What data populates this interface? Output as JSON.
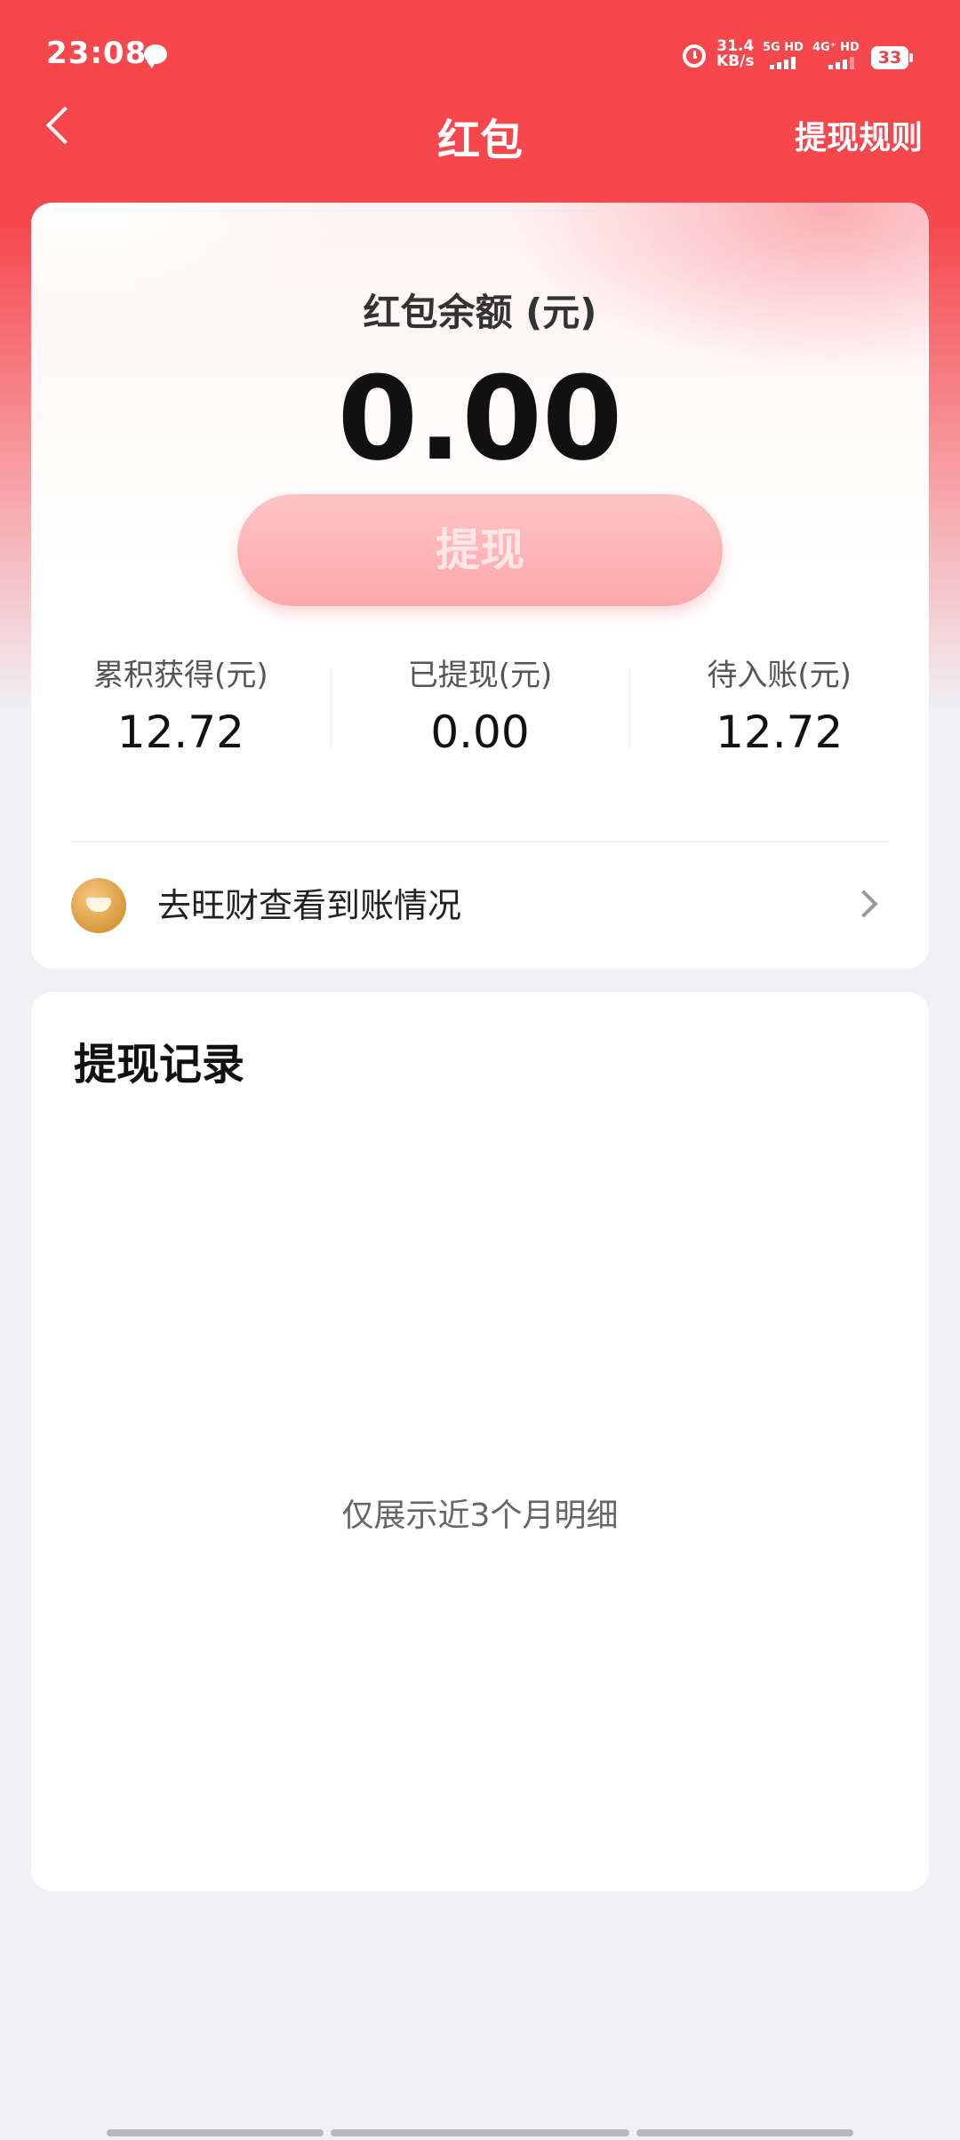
{
  "status_bar": {
    "time": "23:08",
    "net_speed_value": "31.4",
    "net_speed_unit": "KB/s",
    "sim1_label": "5G HD",
    "sim2_label": "4G⁺ HD",
    "battery": "33"
  },
  "nav": {
    "title": "红包",
    "rules_label": "提现规则"
  },
  "balance": {
    "label": "红包余额 (元)",
    "value": "0.00",
    "withdraw_label": "提现"
  },
  "stats": [
    {
      "label": "累积获得(元)",
      "value": "12.72"
    },
    {
      "label": "已提现(元)",
      "value": "0.00"
    },
    {
      "label": "待入账(元)",
      "value": "12.72"
    }
  ],
  "wangcai": {
    "text": "去旺财查看到账情况"
  },
  "records": {
    "title": "提现记录",
    "hint": "仅展示近3个月明细"
  },
  "colors": {
    "header_red": "#f5474c",
    "withdraw_button": "#fca8aa",
    "page_bg": "#f0f0f5"
  }
}
